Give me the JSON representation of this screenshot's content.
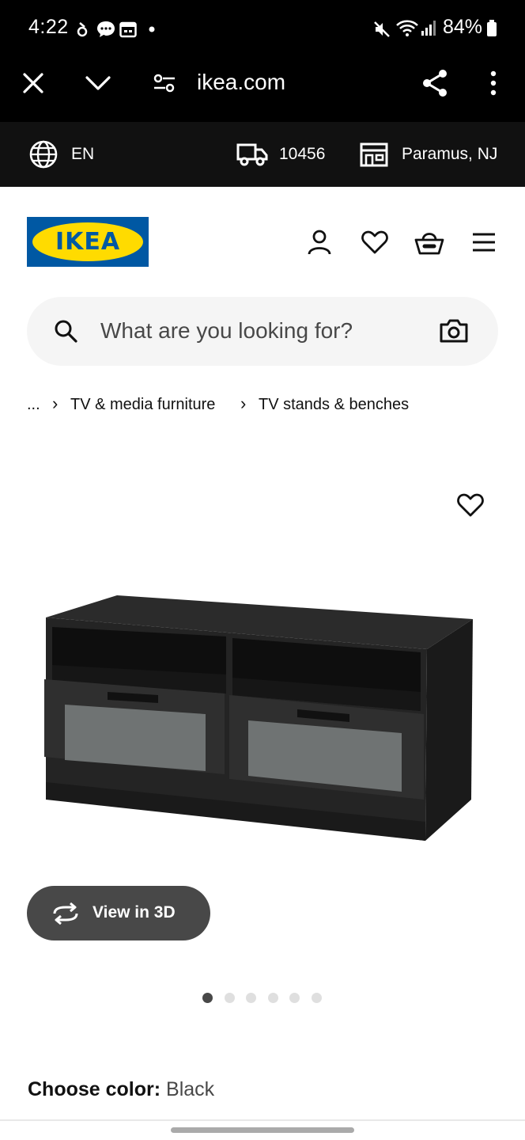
{
  "status_bar": {
    "time": "4:22",
    "battery": "84%",
    "icons": [
      "notification-icon",
      "chat-icon",
      "calendar-icon",
      "dot-icon",
      "mute-icon",
      "wifi-icon",
      "signal-icon",
      "battery-icon"
    ]
  },
  "browser": {
    "url": "ikea.com",
    "icons": [
      "close-icon",
      "chevron-down-icon",
      "site-settings-icon",
      "share-icon",
      "more-vertical-icon"
    ]
  },
  "info_bar": {
    "language": "EN",
    "zip": "10456",
    "store": "Paramus, NJ"
  },
  "header": {
    "logo_text": "IKEA",
    "icons": [
      "account-icon",
      "wishlist-icon",
      "cart-icon",
      "menu-icon"
    ]
  },
  "search": {
    "placeholder": "What are you looking for?"
  },
  "breadcrumb": {
    "ellipsis": "...",
    "items": [
      "TV & media furniture",
      "TV stands & benches"
    ]
  },
  "product": {
    "view_3d_label": "View in 3D",
    "image_count": 6,
    "active_image": 1,
    "color_label": "Choose color:",
    "color_value": "Black"
  },
  "colors": {
    "ikea_blue": "#0058a3",
    "ikea_yellow": "#ffdb00",
    "topbar": "#000000",
    "infobar": "#111111",
    "search_bg": "#f5f5f5",
    "button_dark": "#484848"
  }
}
